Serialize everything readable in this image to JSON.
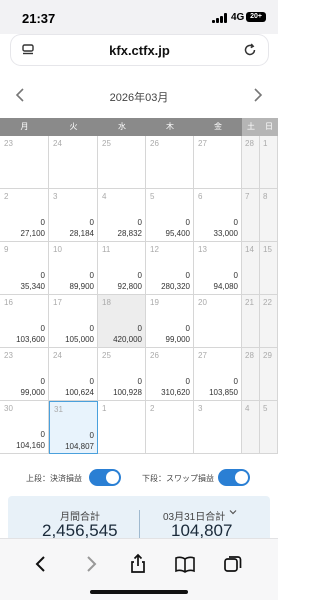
{
  "status_bar": {
    "time": "21:37",
    "network": "4G",
    "battery": "20+"
  },
  "browser": {
    "url": "kfx.ctfx.jp"
  },
  "calendar": {
    "month_title": "2026年03月",
    "weekdays": [
      "月",
      "火",
      "水",
      "木",
      "金",
      "土",
      "日"
    ],
    "weeks": [
      [
        {
          "day": "23",
          "top": "",
          "bottom": ""
        },
        {
          "day": "24",
          "top": "",
          "bottom": ""
        },
        {
          "day": "25",
          "top": "",
          "bottom": ""
        },
        {
          "day": "26",
          "top": "",
          "bottom": ""
        },
        {
          "day": "27",
          "top": "",
          "bottom": ""
        },
        {
          "day": "28",
          "top": "",
          "bottom": ""
        },
        {
          "day": "1",
          "top": "",
          "bottom": ""
        }
      ],
      [
        {
          "day": "2",
          "top": "0",
          "bottom": "27,100"
        },
        {
          "day": "3",
          "top": "0",
          "bottom": "28,184"
        },
        {
          "day": "4",
          "top": "0",
          "bottom": "28,832"
        },
        {
          "day": "5",
          "top": "0",
          "bottom": "95,400"
        },
        {
          "day": "6",
          "top": "0",
          "bottom": "33,000"
        },
        {
          "day": "7",
          "top": "",
          "bottom": ""
        },
        {
          "day": "8",
          "top": "",
          "bottom": ""
        }
      ],
      [
        {
          "day": "9",
          "top": "0",
          "bottom": "35,340"
        },
        {
          "day": "10",
          "top": "0",
          "bottom": "89,900"
        },
        {
          "day": "11",
          "top": "0",
          "bottom": "92,800"
        },
        {
          "day": "12",
          "top": "0",
          "bottom": "280,320"
        },
        {
          "day": "13",
          "top": "0",
          "bottom": "94,080"
        },
        {
          "day": "14",
          "top": "",
          "bottom": ""
        },
        {
          "day": "15",
          "top": "",
          "bottom": ""
        }
      ],
      [
        {
          "day": "16",
          "top": "0",
          "bottom": "103,600"
        },
        {
          "day": "17",
          "top": "0",
          "bottom": "105,000"
        },
        {
          "day": "18",
          "top": "0",
          "bottom": "420,000"
        },
        {
          "day": "19",
          "top": "0",
          "bottom": "99,000"
        },
        {
          "day": "20",
          "top": "",
          "bottom": ""
        },
        {
          "day": "21",
          "top": "",
          "bottom": ""
        },
        {
          "day": "22",
          "top": "",
          "bottom": ""
        }
      ],
      [
        {
          "day": "23",
          "top": "0",
          "bottom": "99,000"
        },
        {
          "day": "24",
          "top": "0",
          "bottom": "100,624"
        },
        {
          "day": "25",
          "top": "0",
          "bottom": "100,928"
        },
        {
          "day": "26",
          "top": "0",
          "bottom": "310,620"
        },
        {
          "day": "27",
          "top": "0",
          "bottom": "103,850"
        },
        {
          "day": "28",
          "top": "",
          "bottom": ""
        },
        {
          "day": "29",
          "top": "",
          "bottom": ""
        }
      ],
      [
        {
          "day": "30",
          "top": "0",
          "bottom": "104,160"
        },
        {
          "day": "31",
          "top": "0",
          "bottom": "104,807"
        },
        {
          "day": "1",
          "top": "",
          "bottom": ""
        },
        {
          "day": "2",
          "top": "",
          "bottom": ""
        },
        {
          "day": "3",
          "top": "",
          "bottom": ""
        },
        {
          "day": "4",
          "top": "",
          "bottom": ""
        },
        {
          "day": "5",
          "top": "",
          "bottom": ""
        }
      ]
    ]
  },
  "toggles": {
    "upper_label": "上段：決済損益",
    "lower_label": "下段：スワップ損益"
  },
  "summary": {
    "monthly_label": "月間合計",
    "monthly_value": "2,456,545",
    "daily_label": "03月31日合計",
    "daily_value": "104,807"
  },
  "colors": {
    "accent": "#2a7fd4",
    "header_gray": "#8a8a8a",
    "today_bg": "#e8f3fc"
  }
}
